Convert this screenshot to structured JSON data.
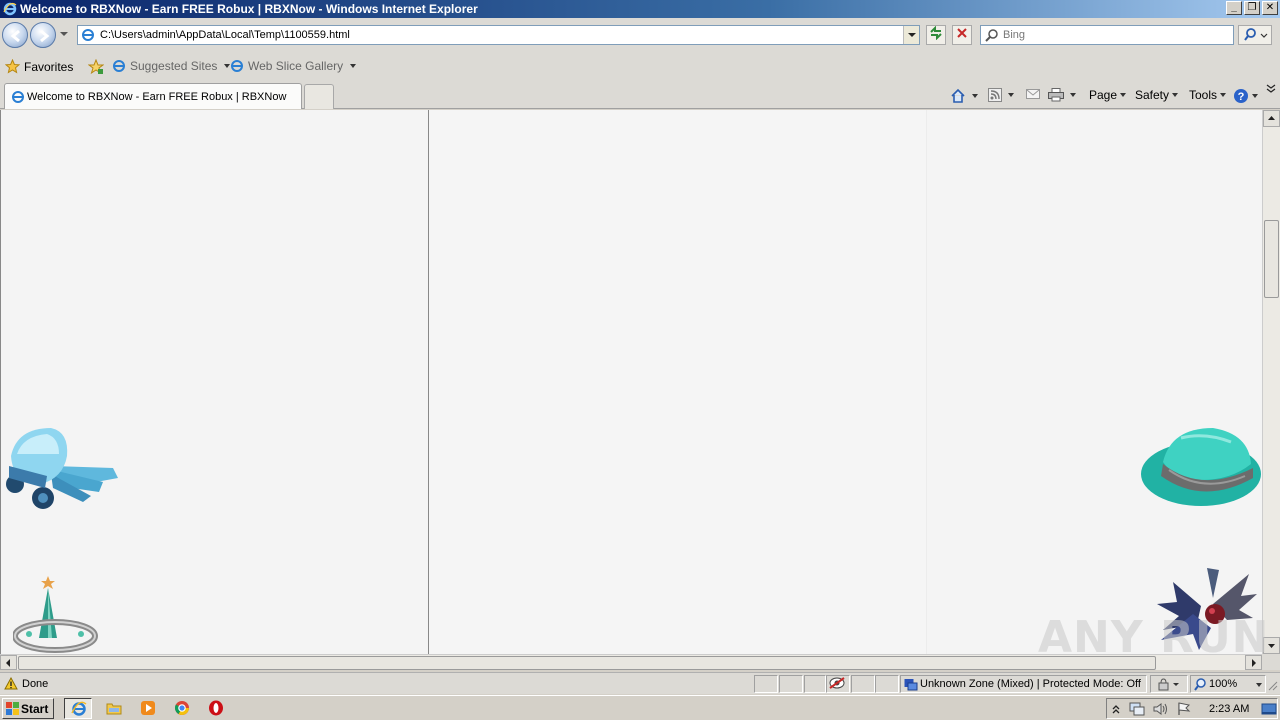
{
  "window": {
    "title": "Welcome to RBXNow - Earn FREE Robux | RBXNow - Windows Internet Explorer",
    "controls": [
      "minimize",
      "restore",
      "close"
    ]
  },
  "address_bar": {
    "url": "C:\\Users\\admin\\AppData\\Local\\Temp\\1100559.html"
  },
  "search": {
    "placeholder": "Bing"
  },
  "favorites_bar": {
    "favorites_label": "Favorites",
    "items": [
      {
        "label": "Suggested Sites"
      },
      {
        "label": "Web Slice Gallery"
      }
    ]
  },
  "tabs": [
    {
      "label": "Welcome to RBXNow - Earn FREE Robux | RBXNow"
    }
  ],
  "command_bar": {
    "page": "Page",
    "safety": "Safety",
    "tools": "Tools"
  },
  "content": {
    "items": [
      {
        "name": "ice-wings-item-image",
        "icon": "crystal-helmet-wings"
      },
      {
        "name": "crown-item-image",
        "icon": "spiked-crown"
      },
      {
        "name": "fedora-item-image",
        "icon": "teal-fedora"
      },
      {
        "name": "dark-wings-item-image",
        "icon": "dark-winged-ornament"
      }
    ]
  },
  "status_bar": {
    "status": "Done",
    "zone": "Unknown Zone (Mixed) | Protected Mode: Off",
    "zoom": "100%"
  },
  "taskbar": {
    "start_label": "Start",
    "apps": [
      "internet-explorer",
      "windows-explorer",
      "media-player",
      "chrome",
      "opera"
    ],
    "clock": "2:23 AM"
  },
  "watermark": {
    "text": "ANY RUN"
  },
  "colors": {
    "titlebar_start": "#0a246a",
    "titlebar_end": "#a6caf0",
    "content_bg": "#f4f4f4",
    "teal_hat": "#2ec4b6"
  }
}
